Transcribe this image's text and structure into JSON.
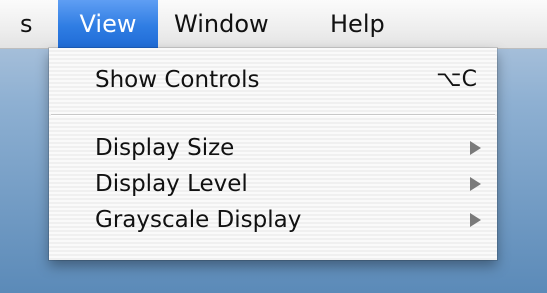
{
  "menubar": {
    "items": [
      {
        "label": "s"
      },
      {
        "label": "View"
      },
      {
        "label": "Window"
      },
      {
        "label": "Help"
      }
    ]
  },
  "view_menu": {
    "items": [
      {
        "label": "Show Controls",
        "shortcut": "⌥C"
      },
      {
        "label": "Display Size",
        "submenu_icon": "triangle-right-icon"
      },
      {
        "label": "Display Level",
        "submenu_icon": "triangle-right-icon"
      },
      {
        "label": "Grayscale Display",
        "submenu_icon": "triangle-right-icon"
      }
    ]
  },
  "colors": {
    "selected_menu_title": "#2f7de3",
    "submenu_arrow": "#7a7a7a"
  }
}
